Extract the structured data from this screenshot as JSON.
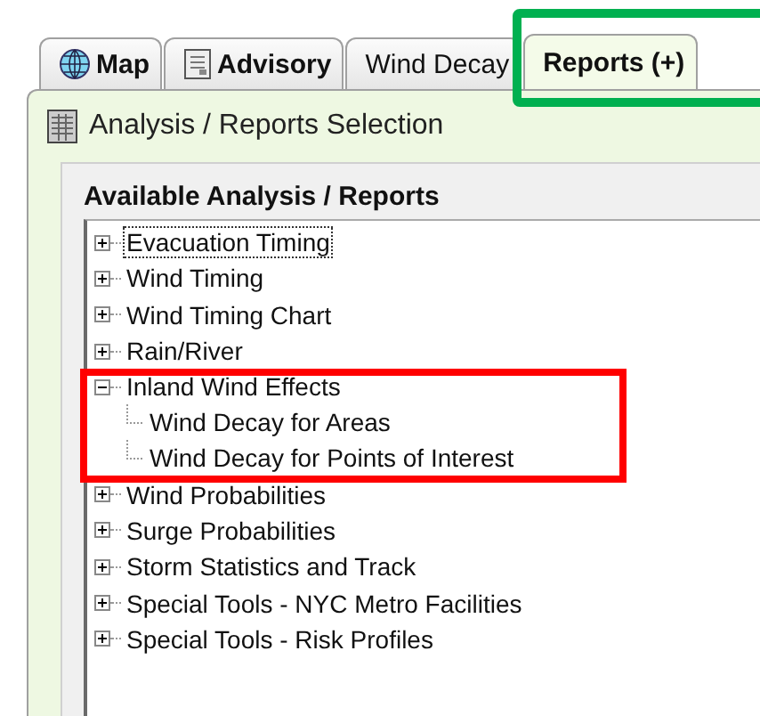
{
  "tabs": [
    {
      "label": "Map",
      "selected": false,
      "highlighted": false
    },
    {
      "label": "Advisory",
      "selected": false,
      "highlighted": false
    },
    {
      "label": "Wind Decay",
      "selected": false,
      "highlighted": false
    },
    {
      "label": "Reports (+)",
      "selected": true,
      "highlighted": true
    }
  ],
  "panel": {
    "title": "Analysis / Reports Selection"
  },
  "group": {
    "title": "Available Analysis / Reports"
  },
  "tree": [
    {
      "label": "Evacuation Timing",
      "expanded": false,
      "focused": true,
      "highlighted": false
    },
    {
      "label": "Wind Timing",
      "expanded": false,
      "focused": false,
      "highlighted": false
    },
    {
      "label": "Wind Timing Chart",
      "expanded": false,
      "focused": false,
      "highlighted": false
    },
    {
      "label": "Rain/River",
      "expanded": false,
      "focused": false,
      "highlighted": false
    },
    {
      "label": "Inland Wind Effects",
      "expanded": true,
      "focused": false,
      "highlighted": true,
      "children": [
        {
          "label": "Wind Decay for Areas"
        },
        {
          "label": "Wind Decay for Points of Interest"
        }
      ]
    },
    {
      "label": "Wind Probabilities",
      "expanded": false,
      "focused": false,
      "highlighted": false
    },
    {
      "label": "Surge Probabilities",
      "expanded": false,
      "focused": false,
      "highlighted": false
    },
    {
      "label": "Storm Statistics and Track",
      "expanded": false,
      "focused": false,
      "highlighted": false
    },
    {
      "label": "Special Tools - NYC Metro Facilities",
      "expanded": false,
      "focused": false,
      "highlighted": false
    },
    {
      "label": "Special Tools - Risk Profiles",
      "expanded": false,
      "focused": false,
      "highlighted": false
    }
  ]
}
